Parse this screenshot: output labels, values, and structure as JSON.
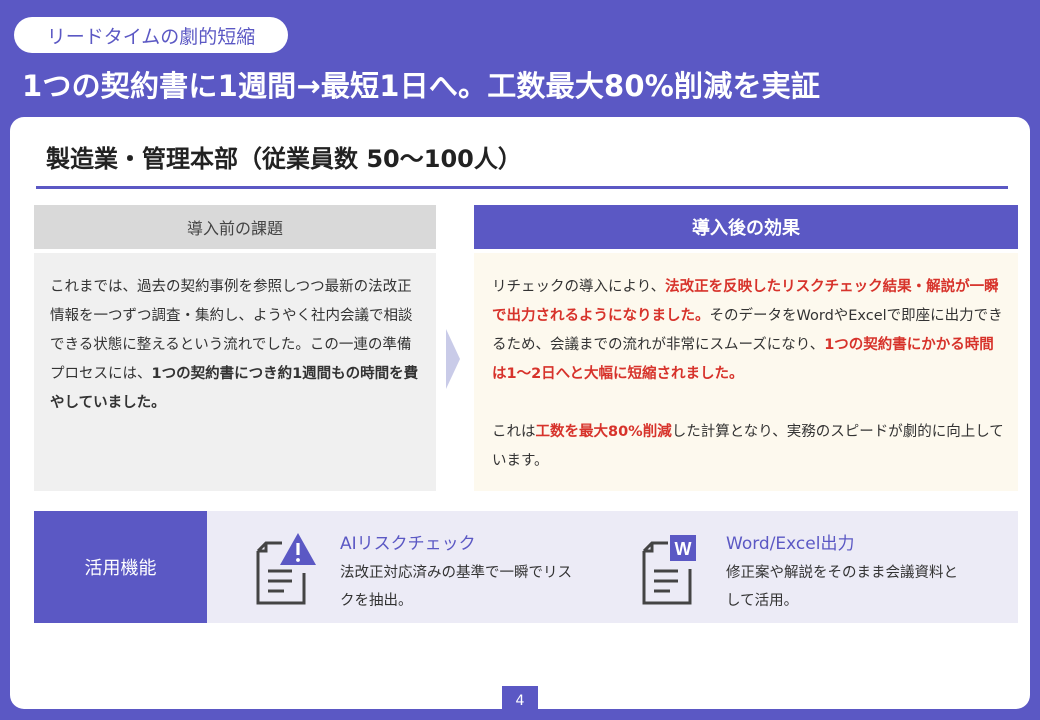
{
  "header": {
    "tag": "リードタイムの劇的短縮",
    "headline": "1つの契約書に1週間→最短1日へ。工数最大80%削減を実証"
  },
  "section": {
    "title": "製造業・管理本部（従業員数 50〜100人）"
  },
  "before": {
    "heading": "導入前の課題",
    "text_1": "これまでは、過去の契約事例を参照しつつ最新の法改正情報を一つずつ調査・集約し、ようやく社内会議で相談できる状態に整えるという流れでした。この一連の準備プロセスには、",
    "text_2_bold": "1つの契約書につき約1週間もの時間を費やしていました。"
  },
  "after": {
    "heading": "導入後の効果",
    "p1_a": "リチェックの導入により、",
    "p1_b_red": "法改正を反映したリスクチェック結果・解説が一瞬で出力されるようになりました。",
    "p1_c": "そのデータをWordやExcelで即座に出力できるため、会議までの流れが非常にスムーズになり、",
    "p1_d_red": "1つの契約書にかかる時間は1〜2日へと大幅に短縮されました。",
    "p2_a": "これは",
    "p2_b_red": "工数を最大80%削減",
    "p2_c": "した計算となり、実務のスピードが劇的に向上しています。"
  },
  "features": {
    "label": "活用機能",
    "items": [
      {
        "icon": "document-warning-icon",
        "title": "AIリスクチェック",
        "description": "法改正対応済みの基準で一瞬でリスクを抽出。"
      },
      {
        "icon": "word-document-icon",
        "icon_letter": "W",
        "title": "Word/Excel出力",
        "description": "修正案や解説をそのまま会議資料として活用。"
      }
    ]
  },
  "page_number": "4",
  "colors": {
    "primary": "#5b58c4",
    "accent_red": "#d7332b",
    "before_bg": "#f0f0f0",
    "after_bg": "#fdf9ee"
  }
}
